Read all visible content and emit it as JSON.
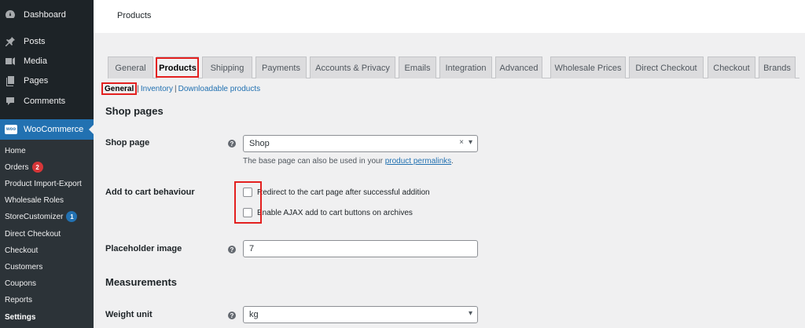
{
  "sidebar": {
    "items": [
      {
        "label": "Dashboard",
        "icon": "dashboard-icon"
      },
      {
        "label": "Posts",
        "icon": "pin-icon"
      },
      {
        "label": "Media",
        "icon": "media-icon"
      },
      {
        "label": "Pages",
        "icon": "pages-icon"
      },
      {
        "label": "Comments",
        "icon": "comments-icon"
      }
    ],
    "woocommerce": {
      "label": "WooCommerce",
      "logo_text": "woo"
    },
    "submenu": [
      {
        "label": "Home"
      },
      {
        "label": "Orders",
        "badge": "2"
      },
      {
        "label": "Product Import-Export"
      },
      {
        "label": "Wholesale Roles"
      },
      {
        "label": "StoreCustomizer",
        "badge": "1"
      },
      {
        "label": "Direct Checkout"
      },
      {
        "label": "Checkout"
      },
      {
        "label": "Customers"
      },
      {
        "label": "Coupons"
      },
      {
        "label": "Reports"
      },
      {
        "label": "Settings"
      }
    ]
  },
  "header": {
    "title": "Products"
  },
  "tabs": [
    {
      "label": "General"
    },
    {
      "label": "Products"
    },
    {
      "label": "Shipping"
    },
    {
      "label": "Payments"
    },
    {
      "label": "Accounts & Privacy"
    },
    {
      "label": "Emails"
    },
    {
      "label": "Integration"
    },
    {
      "label": "Advanced"
    },
    {
      "label": "Wholesale Prices"
    },
    {
      "label": "Direct Checkout"
    },
    {
      "label": "Checkout"
    },
    {
      "label": "Brands"
    }
  ],
  "subnav": {
    "current": "General",
    "links": [
      "Inventory",
      "Downloadable products"
    ],
    "separator": "|"
  },
  "form": {
    "shop_pages_heading": "Shop pages",
    "shop_page": {
      "label": "Shop page",
      "value": "Shop",
      "clear": "×",
      "desc_prefix": "The base page can also be used in your ",
      "desc_link": "product permalinks",
      "desc_suffix": "."
    },
    "add_to_cart": {
      "label": "Add to cart behaviour",
      "options": [
        "Redirect to the cart page after successful addition",
        "Enable AJAX add to cart buttons on archives"
      ]
    },
    "placeholder": {
      "label": "Placeholder image",
      "value": "7"
    },
    "measurements_heading": "Measurements",
    "weight_unit": {
      "label": "Weight unit",
      "value": "kg"
    }
  },
  "colors": {
    "accent": "#2271b1",
    "highlight": "#e3201f",
    "sidebar": "#1d2327",
    "badge_orders": "#d63638",
    "badge_store": "#2271b1"
  }
}
